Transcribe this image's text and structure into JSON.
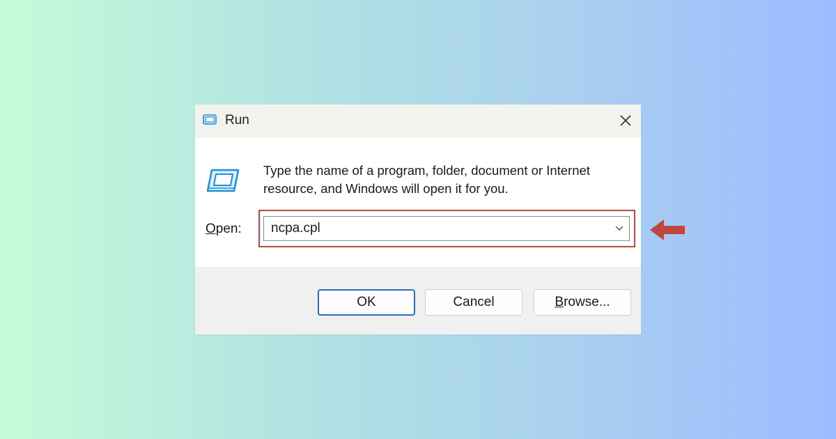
{
  "window": {
    "title": "Run",
    "close_glyph": "✕"
  },
  "body": {
    "prompt": "Type the name of a program, folder, document or Internet resource, and Windows will open it for you.",
    "open_label_first": "O",
    "open_label_rest": "pen:",
    "open_value": "ncpa.cpl"
  },
  "buttons": {
    "ok": "OK",
    "cancel": "Cancel",
    "browse_first": "B",
    "browse_rest": "rowse..."
  },
  "icons": {
    "title": "run-app-icon",
    "big": "run-app-icon",
    "close": "close-icon",
    "dropdown": "chevron-down-icon",
    "annotation": "arrow-left-icon"
  },
  "colors": {
    "annotation_red": "#c0453a",
    "ok_border": "#2e6db8",
    "icon_blue": "#1f8fd6"
  }
}
